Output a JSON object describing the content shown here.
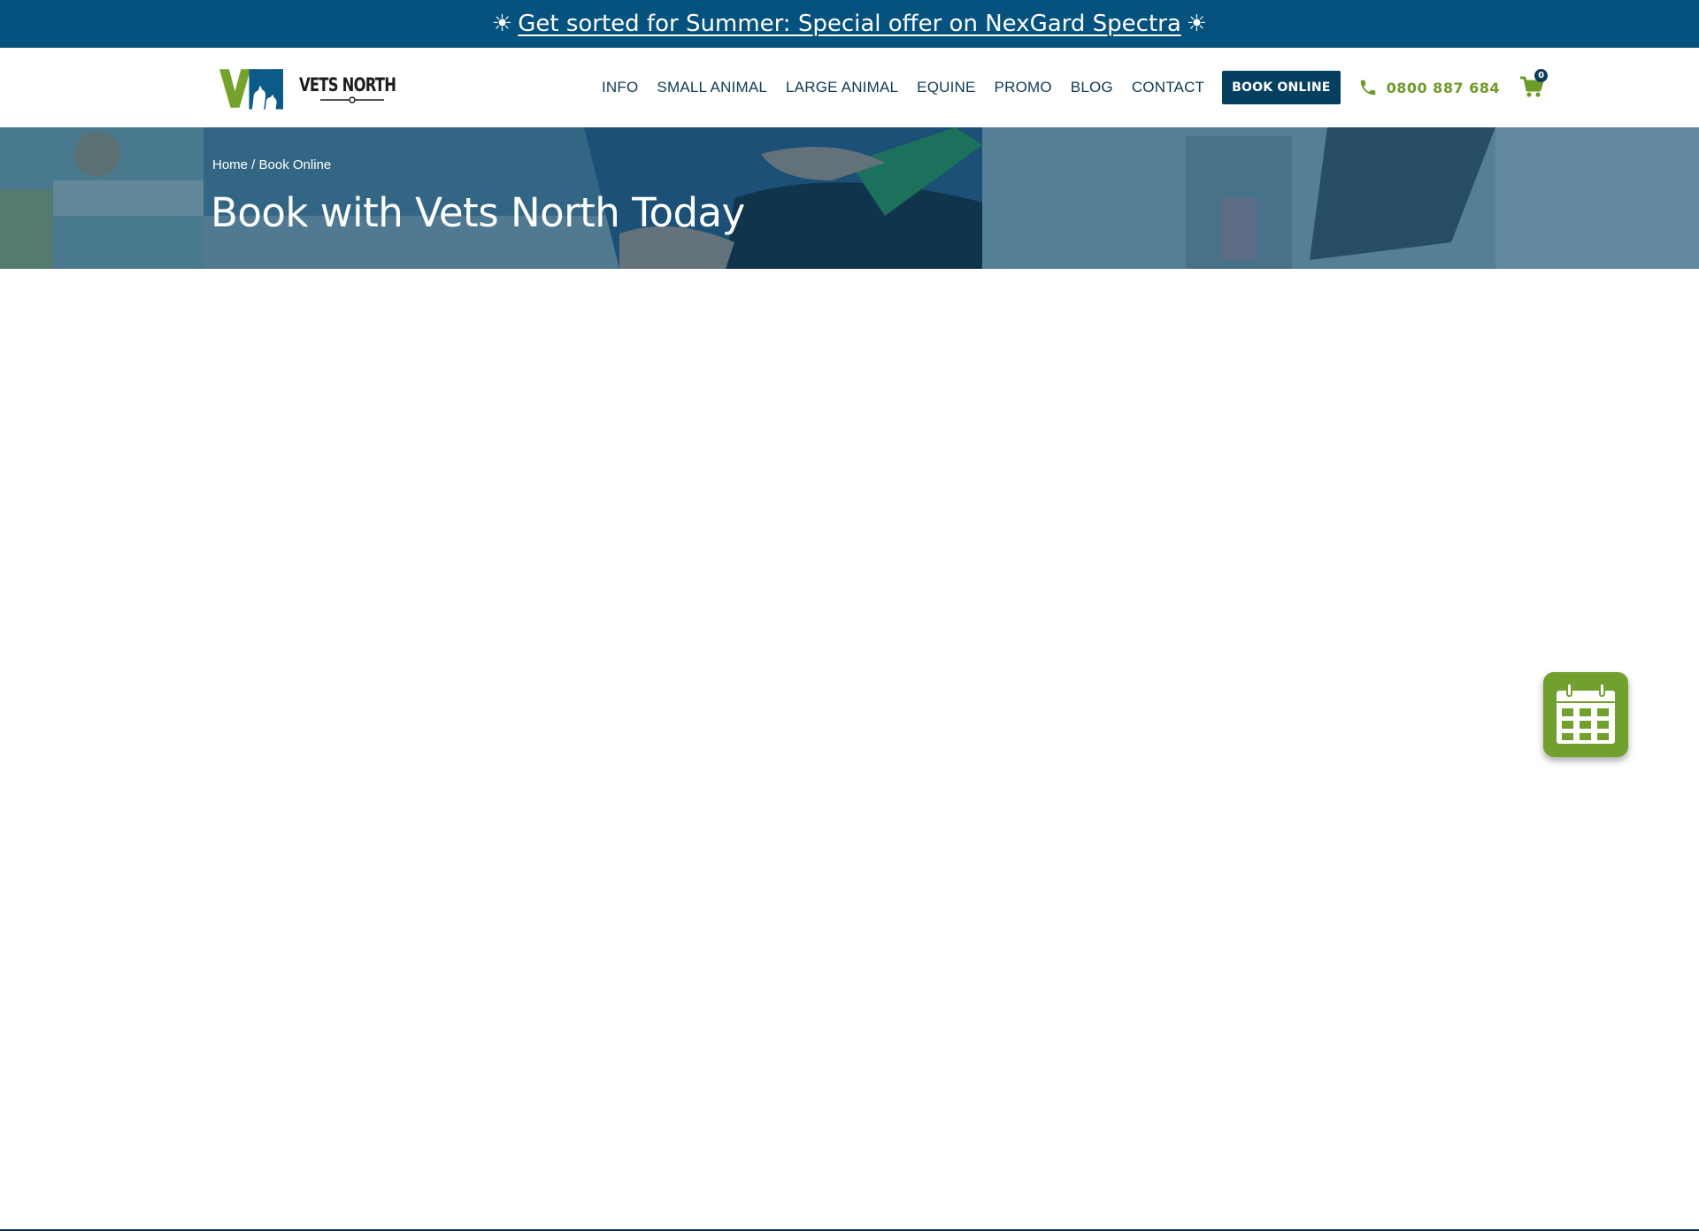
{
  "promo": {
    "icon": "sun-icon",
    "sun_glyph": "☀",
    "link_text": "Get sorted for Summer: Special offer on NexGard Spectra"
  },
  "header": {
    "logo_text": "VETS NORTH",
    "nav_items": [
      "INFO",
      "SMALL ANIMAL",
      "LARGE ANIMAL",
      "EQUINE",
      "PROMO",
      "BLOG",
      "CONTACT"
    ],
    "book_button": "BOOK ONLINE",
    "phone": "0800 887 684",
    "cart_count": "0"
  },
  "hero": {
    "breadcrumb": {
      "home": "Home",
      "separator": " / ",
      "current": "Book Online"
    },
    "title": "Book with Vets North Today"
  },
  "floating": {
    "icon": "calendar-icon"
  },
  "colors": {
    "brand_blue": "#06527f",
    "navy": "#073f61",
    "brand_green": "#72a02f",
    "nav_text": "#0e3a55"
  }
}
